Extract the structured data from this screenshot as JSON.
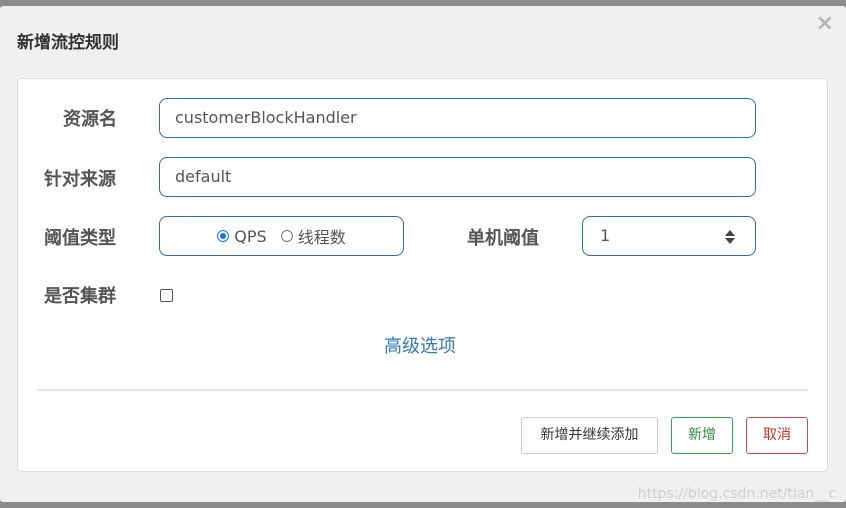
{
  "dialog": {
    "title": "新增流控规则",
    "close_symbol": "×"
  },
  "form": {
    "resource_name": {
      "label": "资源名",
      "value": "customerBlockHandler"
    },
    "limit_app": {
      "label": "针对来源",
      "value": "default"
    },
    "threshold_type": {
      "label": "阈值类型",
      "options": [
        "QPS",
        "线程数"
      ],
      "selected": "QPS"
    },
    "single_threshold": {
      "label": "单机阈值",
      "value": "1"
    },
    "cluster_mode": {
      "label": "是否集群",
      "checked": false
    },
    "advanced_link": "高级选项"
  },
  "buttons": {
    "add_and_continue": "新增并继续添加",
    "add": "新增",
    "cancel": "取消"
  },
  "watermark": "https://blog.csdn.net/tian__c",
  "colors": {
    "input_border": "#2d6fa4",
    "link": "#337ab7",
    "success": "#33a850",
    "danger": "#d0434f"
  }
}
